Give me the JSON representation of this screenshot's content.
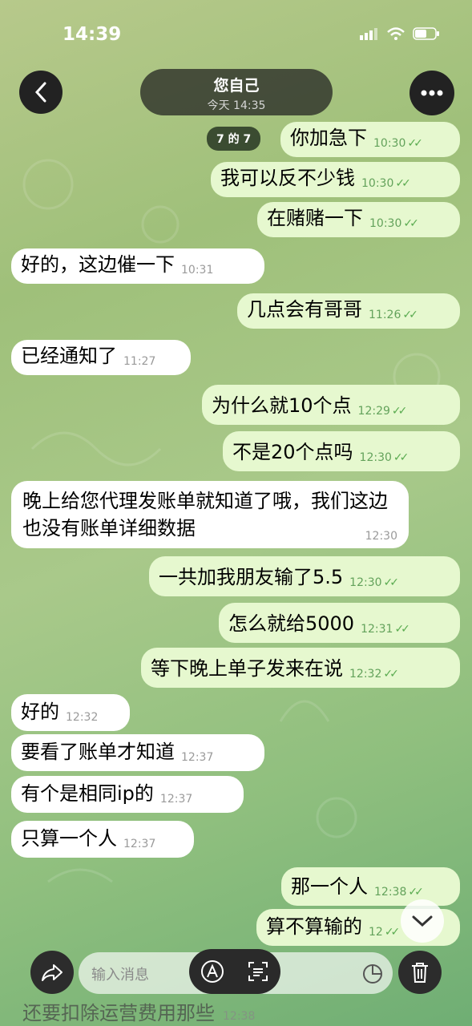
{
  "status_bar": {
    "time": "14:39"
  },
  "header": {
    "title": "您自己",
    "subtitle": "今天 14:35",
    "counter": "7 的 7"
  },
  "messages": [
    {
      "dir": "out",
      "text": "你加急下",
      "time": "10:30"
    },
    {
      "dir": "out",
      "text": "我可以反不少钱",
      "time": "10:30"
    },
    {
      "dir": "out",
      "text": "在赌赌一下",
      "time": "10:30"
    },
    {
      "dir": "in",
      "text": "好的，这边催一下",
      "time": "10:31"
    },
    {
      "dir": "out",
      "text": "几点会有哥哥",
      "time": "11:26"
    },
    {
      "dir": "in",
      "text": "已经通知了",
      "time": "11:27"
    },
    {
      "dir": "out",
      "text": "为什么就10个点",
      "time": "12:29"
    },
    {
      "dir": "out",
      "text": "不是20个点吗",
      "time": "12:30"
    },
    {
      "dir": "in",
      "text": "晚上给您代理发账单就知道了哦，我们这边也没有账单详细数据",
      "time": "12:30"
    },
    {
      "dir": "out",
      "text": "一共加我朋友输了5.5",
      "time": "12:30"
    },
    {
      "dir": "out",
      "text": "怎么就给5000",
      "time": "12:31"
    },
    {
      "dir": "out",
      "text": "等下晚上单子发来在说",
      "time": "12:32"
    },
    {
      "dir": "in",
      "text": "好的",
      "time": "12:32"
    },
    {
      "dir": "in",
      "text": "要看了账单才知道",
      "time": "12:37"
    },
    {
      "dir": "in",
      "text": "有个是相同ip的",
      "time": "12:37"
    },
    {
      "dir": "in",
      "text": "只算一个人",
      "time": "12:37"
    },
    {
      "dir": "out",
      "text": "那一个人",
      "time": "12:38"
    },
    {
      "dir": "out",
      "text": "算不算输的",
      "time": "12"
    }
  ],
  "faded_message": {
    "text": "还要扣除运营费用那些",
    "time": "12:38"
  },
  "composer": {
    "placeholder": "输入消息"
  }
}
